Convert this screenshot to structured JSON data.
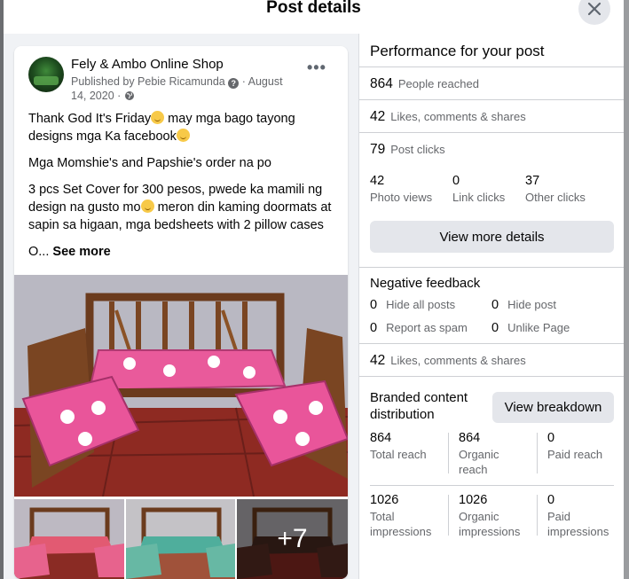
{
  "dialog": {
    "title": "Post details"
  },
  "post": {
    "page_name": "Fely & Ambo Online Shop",
    "published_by": "Published by Pebie Ricamunda",
    "date": "August 14, 2020",
    "text_line1": "Thank God It's Friday",
    "text_line1b": " may mga bago tayong designs mga Ka facebook",
    "text_line2": "Mga Momshie's and Papshie's order na po",
    "text_line3a": "3 pcs Set Cover for 300 pesos, pwede ka mamili ng design na gusto mo",
    "text_line3b": " meron din kaming doormats at sapin sa higaan, mga bedsheets with 2 pillow cases",
    "text_line4": "O... ",
    "see_more": "See more",
    "more_photos_count": "+7"
  },
  "performance": {
    "title": "Performance for your post",
    "people_reached": {
      "value": "864",
      "label": "People reached"
    },
    "engagement": {
      "value": "42",
      "label": "Likes, comments & shares"
    },
    "post_clicks": {
      "value": "79",
      "label": "Post clicks"
    },
    "photo_views": {
      "value": "42",
      "label": "Photo views"
    },
    "link_clicks": {
      "value": "0",
      "label": "Link clicks"
    },
    "other_clicks": {
      "value": "37",
      "label": "Other clicks"
    },
    "view_more_label": "View more details",
    "negative": {
      "title": "Negative feedback",
      "hide_all": {
        "value": "0",
        "label": "Hide all posts"
      },
      "hide_post": {
        "value": "0",
        "label": "Hide post"
      },
      "spam": {
        "value": "0",
        "label": "Report as spam"
      },
      "unlike": {
        "value": "0",
        "label": "Unlike Page"
      }
    },
    "engagement2": {
      "value": "42",
      "label": "Likes, comments & shares"
    },
    "branded": {
      "title": "Branded content distribution",
      "button_label": "View breakdown",
      "total_reach": {
        "value": "864",
        "label": "Total reach"
      },
      "organic_reach": {
        "value": "864",
        "label": "Organic reach"
      },
      "paid_reach": {
        "value": "0",
        "label": "Paid reach"
      },
      "total_impressions": {
        "value": "1026",
        "label": "Total impressions"
      },
      "organic_impressions": {
        "value": "1026",
        "label": "Organic impressions"
      },
      "paid_impressions": {
        "value": "0",
        "label": "Paid impressions"
      }
    }
  },
  "icons": [
    "close-icon",
    "help-icon",
    "globe-icon",
    "more-options-icon",
    "emoji-icon"
  ]
}
